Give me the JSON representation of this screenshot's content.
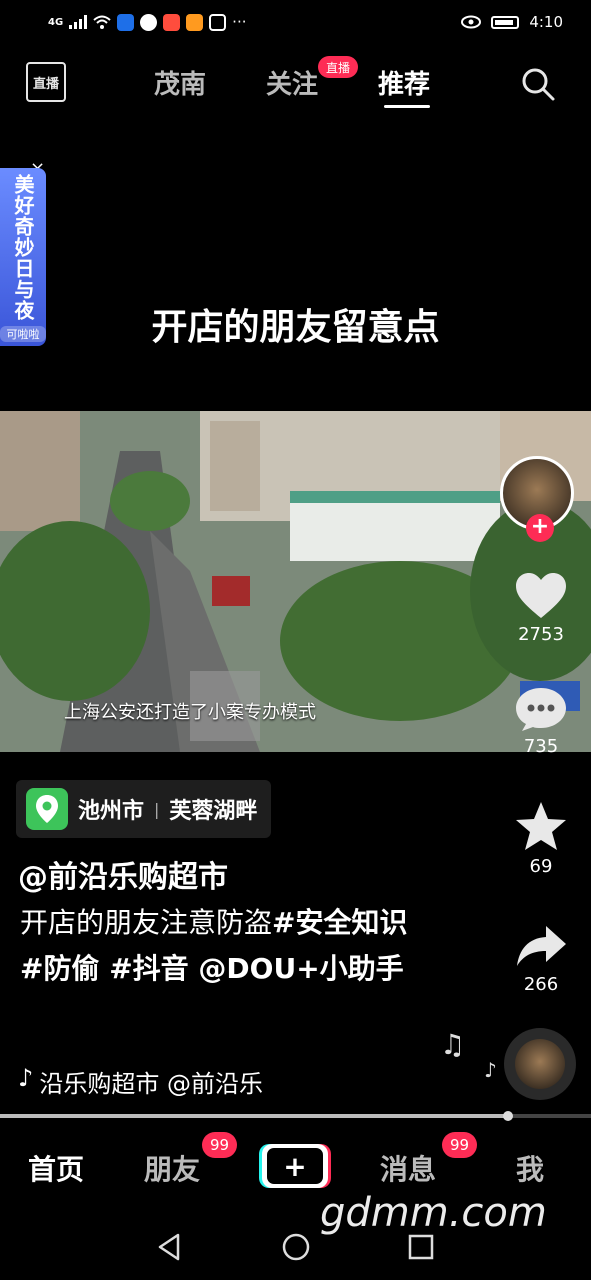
{
  "status_bar": {
    "network": "4G",
    "time": "4:10",
    "more": "···"
  },
  "top_nav": {
    "live_icon": "直播",
    "tabs": [
      {
        "label": "茂南"
      },
      {
        "label": "关注",
        "badge": "直播"
      },
      {
        "label": "推荐",
        "active": true
      }
    ],
    "search_icon": "search-icon"
  },
  "ad": {
    "text": "美好奇妙日与夜",
    "sub": "可啦啦",
    "close": "×"
  },
  "video": {
    "caption": "开店的朋友留意点",
    "subtitle": "上海公安还打造了小案专办模式"
  },
  "actions": {
    "likes": "2753",
    "comments": "735",
    "favorites": "69",
    "shares": "266"
  },
  "location": {
    "city": "池州市",
    "separator": "|",
    "place": "芙蓉湖畔"
  },
  "author": "@前沿乐购超市",
  "description": {
    "text": "开店的朋友注意防盗",
    "tags": "#安全知识 #防偷 #抖音 @DOU+小助手"
  },
  "music": {
    "icon": "♪",
    "text": "沿乐购超市    @前沿乐"
  },
  "progress": {
    "fraction": 0.86
  },
  "bottom_tabs": {
    "home": "首页",
    "friends": "朋友",
    "friends_badge": "99",
    "create": "+",
    "messages": "消息",
    "messages_badge": "99",
    "me": "我"
  },
  "watermark": "gdmm.com",
  "colors": {
    "accent": "#fe2c55",
    "location_green": "#3dc45a",
    "cyan": "#25f4ee"
  }
}
